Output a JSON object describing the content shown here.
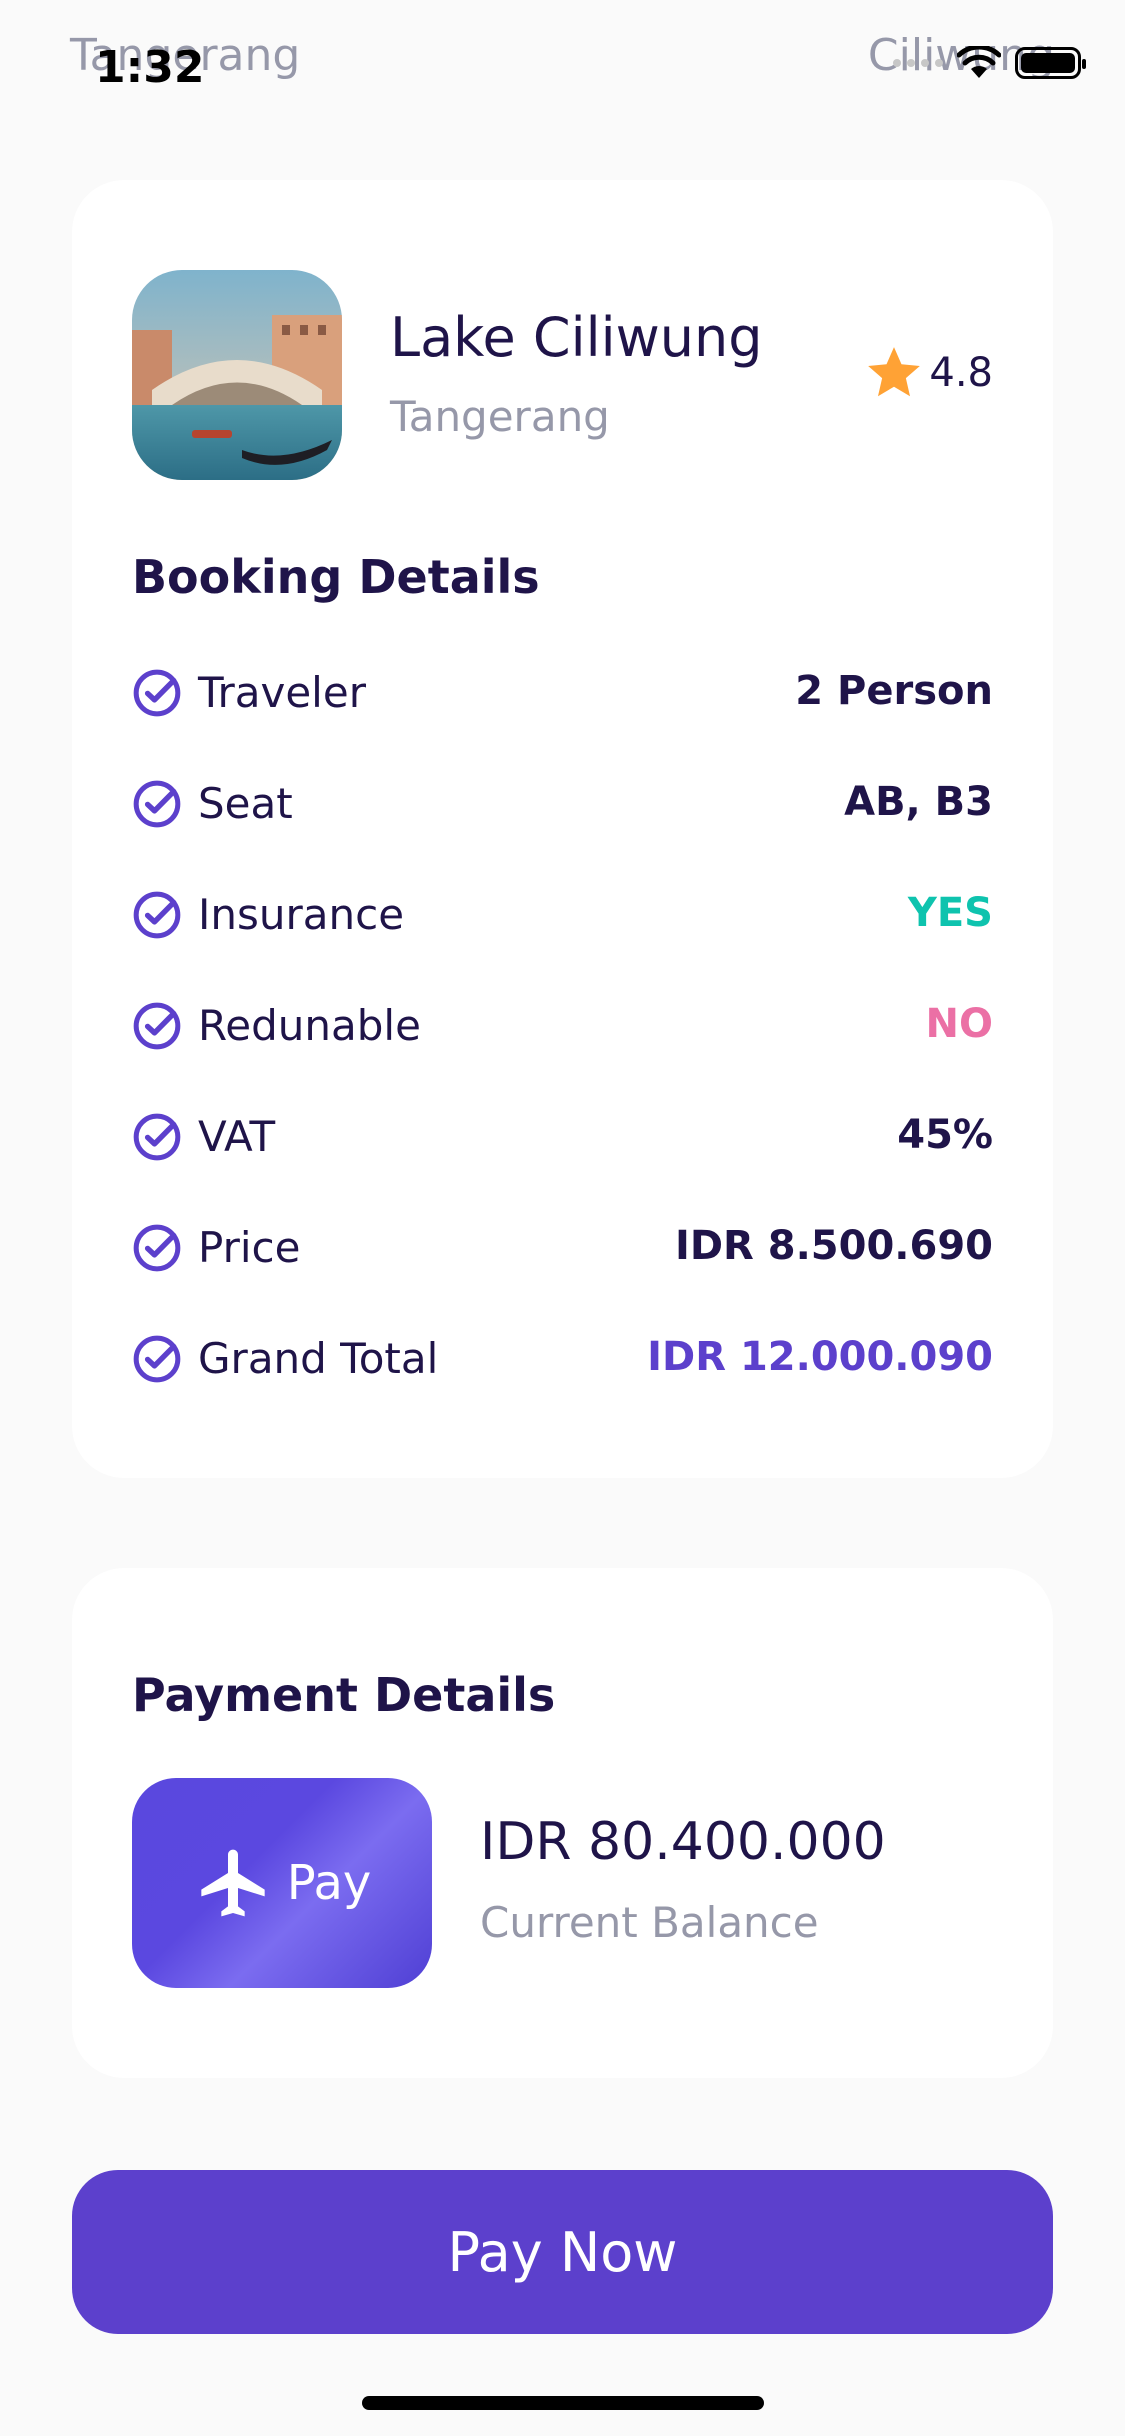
{
  "status_bar": {
    "time": "1:32",
    "ghost_left": "Tangerang",
    "ghost_right": "Ciliwung"
  },
  "destination": {
    "name": "Lake Ciliwung",
    "city": "Tangerang",
    "rating": "4.8"
  },
  "booking": {
    "title": "Booking Details",
    "rows": [
      {
        "label": "Traveler",
        "value": "2 Person",
        "value_color": "#1F1449"
      },
      {
        "label": "Seat",
        "value": "AB, B3",
        "value_color": "#1F1449"
      },
      {
        "label": "Insurance",
        "value": "YES",
        "value_color": "#0EC3AE"
      },
      {
        "label": "Redunable",
        "value": "NO",
        "value_color": "#EB70A5"
      },
      {
        "label": "VAT",
        "value": "45%",
        "value_color": "#1F1449"
      },
      {
        "label": "Price",
        "value": "IDR 8.500.690",
        "value_color": "#1F1449"
      },
      {
        "label": "Grand Total",
        "value": "IDR 12.000.090",
        "value_color": "#5C40CC"
      }
    ]
  },
  "payment": {
    "title": "Payment Details",
    "card_label": "Pay",
    "balance_amount": "IDR 80.400.000",
    "balance_label": "Current Balance"
  },
  "actions": {
    "pay_now_label": "Pay Now"
  },
  "icons": {
    "check": "check-circle-icon",
    "star": "star-icon",
    "plane": "plane-icon"
  },
  "colors": {
    "primary": "#5C40CC",
    "text_dark": "#1F1449",
    "text_gray": "#9698A9",
    "star": "#FFA235",
    "green": "#0EC3AE",
    "pink": "#EB70A5"
  }
}
